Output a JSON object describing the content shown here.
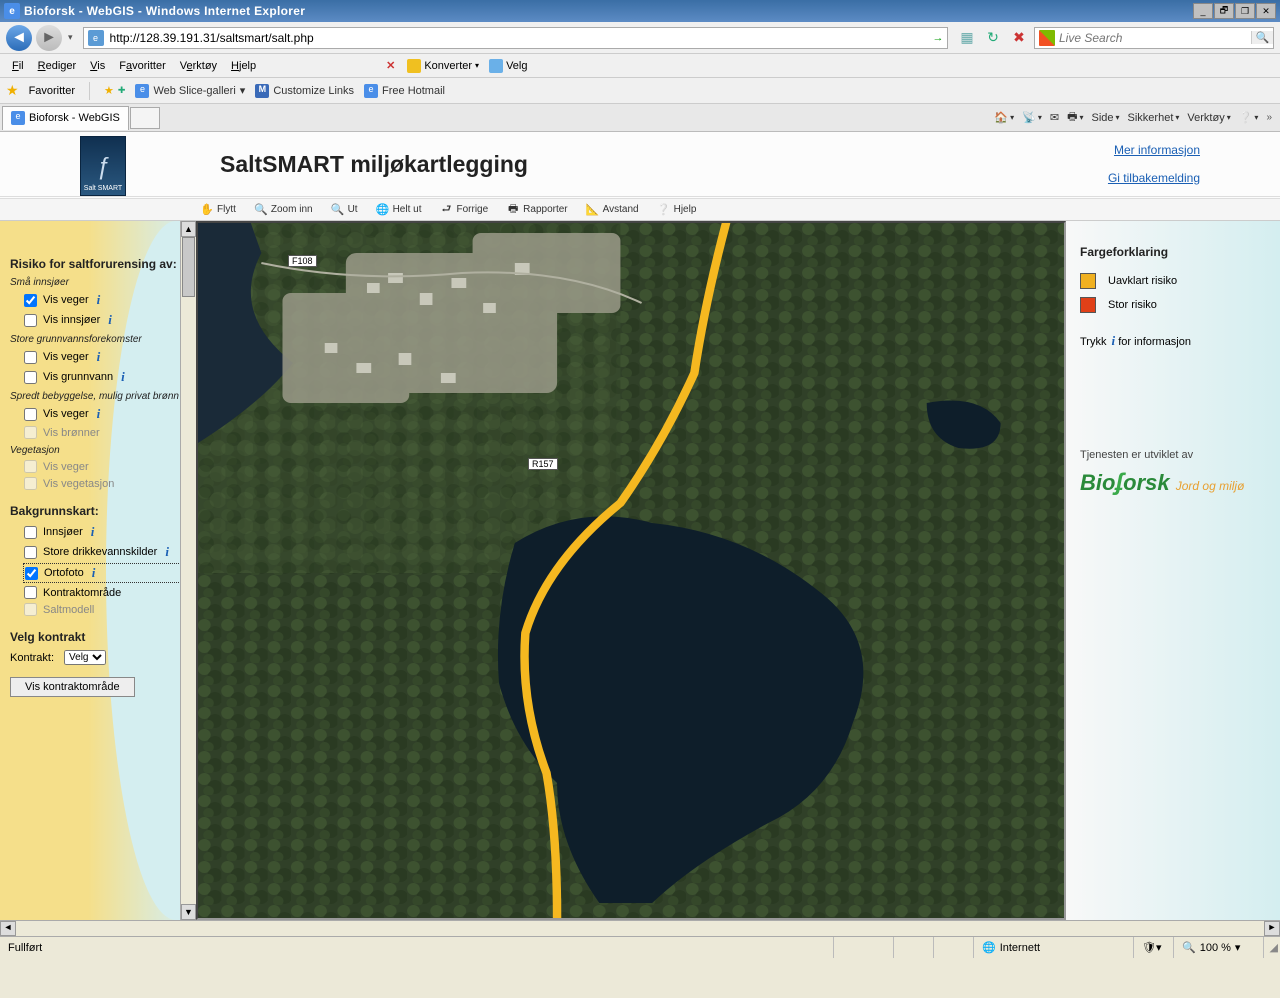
{
  "window": {
    "title": "Bioforsk - WebGIS - Windows Internet Explorer",
    "min": "_",
    "max": "❐",
    "restore": "🗗",
    "close": "✕"
  },
  "nav": {
    "url": "http://128.39.191.31/saltsmart/salt.php",
    "search_placeholder": "Live Search"
  },
  "menu": {
    "fil": "Fil",
    "rediger": "Rediger",
    "vis": "Vis",
    "favoritter": "Favoritter",
    "verktoy": "Verktøy",
    "hjelp": "Hjelp",
    "konverter": "Konverter",
    "velg": "Velg"
  },
  "favbar": {
    "favoritter": "Favoritter",
    "webslice": "Web Slice-galleri",
    "customize": "Customize Links",
    "freehotmail": "Free Hotmail"
  },
  "tab": {
    "title": "Bioforsk - WebGIS"
  },
  "commands": {
    "side": "Side",
    "sikkerhet": "Sikkerhet",
    "verktoy": "Verktøy"
  },
  "app": {
    "logo_text": "Salt SMART",
    "title": "SaltSMART miljøkartlegging",
    "mer": "Mer informasjon",
    "tilbake": "Gi tilbakemelding"
  },
  "toolbar": {
    "flytt": "Flytt",
    "zoominn": "Zoom inn",
    "ut": "Ut",
    "heltut": "Helt ut",
    "forrige": "Forrige",
    "rapporter": "Rapporter",
    "avstand": "Avstand",
    "hjelp": "Hjelp"
  },
  "roads": {
    "f108": "F108",
    "r157": "R157"
  },
  "sidebar": {
    "risk_h": "Risiko for saltforurensing av:",
    "grp1": "Små innsjøer",
    "grp1_a": "Vis veger",
    "grp1_b": "Vis innsjøer",
    "grp2": "Store grunnvannsforekomster",
    "grp2_a": "Vis veger",
    "grp2_b": "Vis grunnvann",
    "grp3": "Spredt bebyggelse, mulig privat brønn",
    "grp3_a": "Vis veger",
    "grp3_b": "Vis brønner",
    "grp4": "Vegetasjon",
    "grp4_a": "Vis veger",
    "grp4_b": "Vis vegetasjon",
    "bakgrunn_h": "Bakgrunnskart:",
    "bk1": "Innsjøer",
    "bk2": "Store drikkevannskilder",
    "bk3": "Ortofoto",
    "bk4": "Kontraktområde",
    "bk5": "Saltmodell",
    "velg_h": "Velg kontrakt",
    "kontrakt_lbl": "Kontrakt:",
    "kontrakt_opt": "Velg",
    "vis_btn": "Vis kontraktområde"
  },
  "right": {
    "legend_h": "Fargeforklaring",
    "leg1": "Uavklart risiko",
    "leg1_color": "#f0b020",
    "leg2": "Stor risiko",
    "leg2_color": "#e04018",
    "trykk": "Trykk",
    "for_info": "for informasjon",
    "dev": "Tjenesten er utviklet av",
    "bio": "Bio",
    "forsk": "orsk",
    "sub": "Jord og miljø"
  },
  "status": {
    "fullfort": "Fullført",
    "internett": "Internett",
    "zoom": "100 %"
  }
}
